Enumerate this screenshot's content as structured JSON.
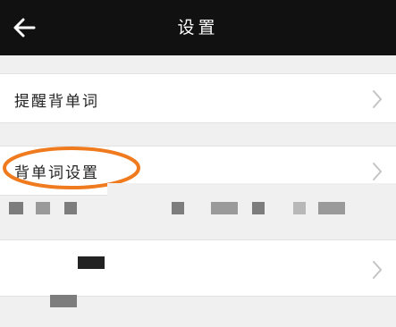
{
  "header": {
    "title": "设置",
    "back_icon": "arrow-left-icon"
  },
  "settings": {
    "items": [
      {
        "label": "提醒背单词",
        "chevron_icon": "chevron-right-icon"
      },
      {
        "label": "背单词设置",
        "chevron_icon": "chevron-right-icon",
        "highlighted": true
      },
      {
        "label": "",
        "chevron_icon": "chevron-right-icon",
        "redacted": true
      }
    ]
  },
  "colors": {
    "app_bar": "#111111",
    "background": "#f0f0f0",
    "row_background": "#ffffff",
    "highlight_oval": "#f07a1e",
    "chevron": "#c4c4c4"
  }
}
